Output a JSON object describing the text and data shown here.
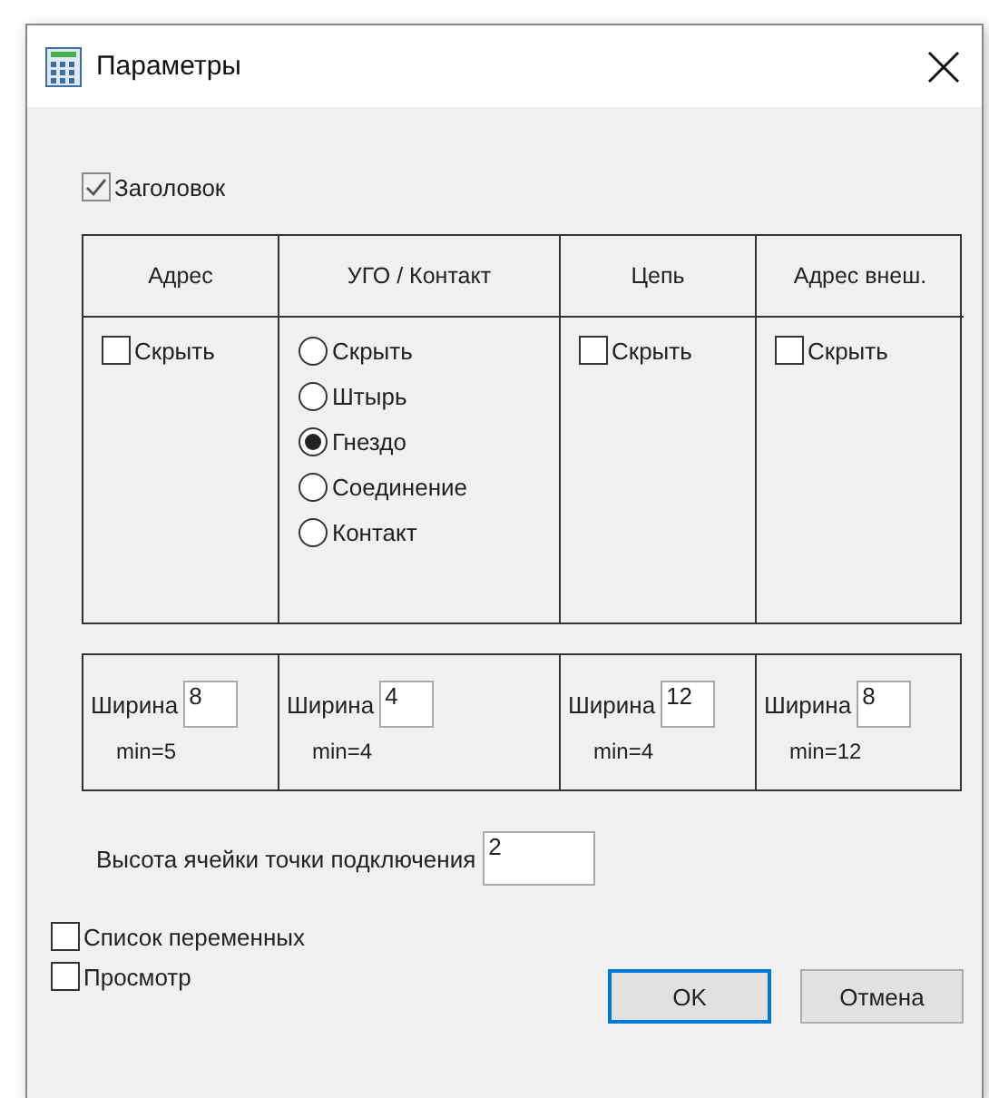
{
  "window": {
    "title": "Параметры"
  },
  "header_checkbox": {
    "label": "Заголовок",
    "checked": true
  },
  "columns": [
    {
      "heading": "Адрес",
      "kind": "checkbox",
      "label": "Скрыть",
      "checked": false
    },
    {
      "heading": "УГО / Контакт",
      "kind": "radio",
      "options": [
        {
          "label": "Скрыть",
          "selected": false
        },
        {
          "label": "Штырь",
          "selected": false
        },
        {
          "label": "Гнездо",
          "selected": true
        },
        {
          "label": "Соединение",
          "selected": false
        },
        {
          "label": "Контакт",
          "selected": false
        }
      ]
    },
    {
      "heading": "Цепь",
      "kind": "checkbox",
      "label": "Скрыть",
      "checked": false
    },
    {
      "heading": "Адрес внеш.",
      "kind": "checkbox",
      "label": "Скрыть",
      "checked": false
    }
  ],
  "widths": [
    {
      "label": "Ширина",
      "value": "8",
      "min": "min=5"
    },
    {
      "label": "Ширина",
      "value": "4",
      "min": "min=4"
    },
    {
      "label": "Ширина",
      "value": "12",
      "min": "min=4"
    },
    {
      "label": "Ширина",
      "value": "8",
      "min": "min=12"
    }
  ],
  "cell_height": {
    "label": "Высота ячейки точки подключения",
    "value": "2"
  },
  "options": [
    {
      "label": "Список переменных",
      "checked": false
    },
    {
      "label": "Просмотр",
      "checked": false
    }
  ],
  "buttons": [
    {
      "label": "OK",
      "default": true
    },
    {
      "label": "Отмена",
      "default": false
    }
  ]
}
